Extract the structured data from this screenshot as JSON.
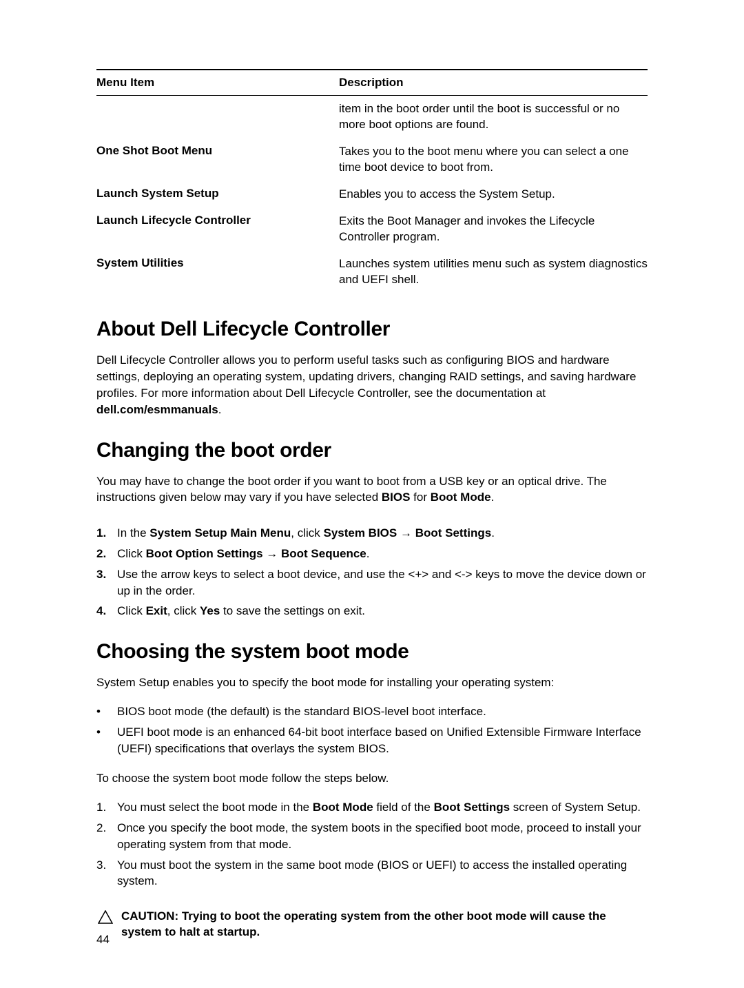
{
  "table": {
    "header_menu": "Menu Item",
    "header_desc": "Description",
    "rows": [
      {
        "menu": "",
        "desc": "item in the boot order until the boot is successful or no more boot options are found."
      },
      {
        "menu": "One Shot Boot Menu",
        "desc": "Takes you to the boot menu where you can select a one time boot device to boot from."
      },
      {
        "menu": "Launch System Setup",
        "desc": "Enables you to access the System Setup."
      },
      {
        "menu": "Launch Lifecycle Controller",
        "desc": "Exits the Boot Manager and invokes the Lifecycle Controller program."
      },
      {
        "menu": "System Utilities",
        "desc": "Launches system utilities menu such as system diagnostics and UEFI shell."
      }
    ]
  },
  "section1": {
    "heading": "About Dell Lifecycle Controller",
    "p1a": "Dell Lifecycle Controller allows you to perform useful tasks such as configuring BIOS and hardware settings, deploying an operating system, updating drivers, changing RAID settings, and saving hardware profiles. For more information about Dell Lifecycle Controller, see the documentation at ",
    "p1b": "dell.com/esmmanuals",
    "p1c": "."
  },
  "section2": {
    "heading": "Changing the boot order",
    "p1a": "You may have to change the boot order if you want to boot from a USB key or an optical drive. The instructions given below may vary if you have selected ",
    "p1b": "BIOS",
    "p1c": " for ",
    "p1d": "Boot Mode",
    "p1e": ".",
    "steps": [
      {
        "n": "1.",
        "a": "In the ",
        "b": "System Setup Main Menu",
        "c": ", click ",
        "d": "System BIOS",
        "e": " → ",
        "f": "Boot Settings",
        "g": "."
      },
      {
        "n": "2.",
        "a": "Click ",
        "b": "Boot Option Settings",
        "c": " → ",
        "d": "Boot Sequence",
        "e": "."
      },
      {
        "n": "3.",
        "a": "Use the arrow keys to select a boot device, and use the <+> and <-> keys to move the device down or up in the order."
      },
      {
        "n": "4.",
        "a": "Click ",
        "b": "Exit",
        "c": ", click ",
        "d": "Yes",
        "e": " to save the settings on exit."
      }
    ]
  },
  "section3": {
    "heading": "Choosing the system boot mode",
    "p1": "System Setup enables you to specify the boot mode for installing your operating system:",
    "bullets": [
      "BIOS boot mode (the default) is the standard BIOS-level boot interface.",
      "UEFI boot mode is an enhanced 64-bit boot interface based on Unified Extensible Firmware Interface (UEFI) specifications that overlays the system BIOS."
    ],
    "p2": "To choose the system boot mode follow the steps below.",
    "steps": [
      {
        "n": "1.",
        "a": "You must select the boot mode in the ",
        "b": "Boot Mode",
        "c": " field of the ",
        "d": "Boot Settings",
        "e": " screen of System Setup."
      },
      {
        "n": "2.",
        "a": "Once you specify the boot mode, the system boots in the specified boot mode, proceed to install your operating system from that mode."
      },
      {
        "n": "3.",
        "a": "You must boot the system in the same boot mode (BIOS or UEFI) to access the installed operating system."
      }
    ],
    "caution": "CAUTION: Trying to boot the operating system from the other boot mode will cause the system to halt at startup."
  },
  "page_number": "44"
}
